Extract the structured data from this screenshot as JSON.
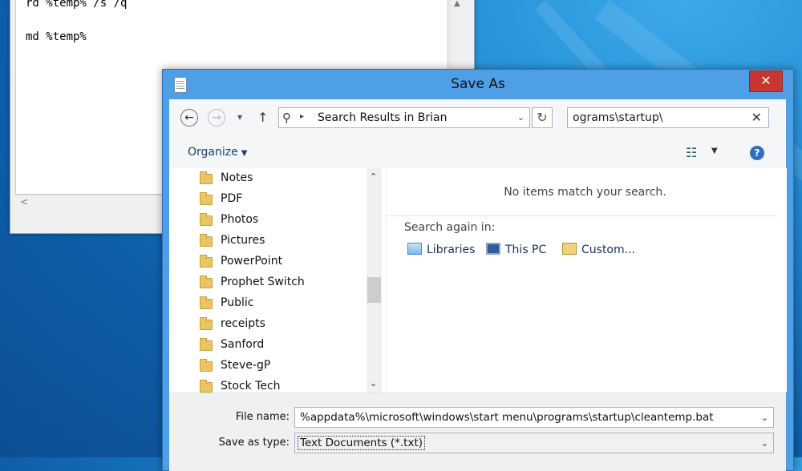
{
  "notepad": {
    "lines": [
      "rd %temp% /s /q",
      "",
      "md %temp%"
    ],
    "hscroll_left": "<"
  },
  "dialog": {
    "title": "Save As",
    "close_glyph": "✕",
    "nav": {
      "back_glyph": "←",
      "forward_glyph": "→",
      "recent_glyph": "▾",
      "up_glyph": "↑"
    },
    "address": {
      "search_icon": "⚲",
      "separator": "▸",
      "path": "Search Results in Brian",
      "dropdown": "⌄",
      "refresh_glyph": "↻"
    },
    "search": {
      "value": "ograms\\startup\\",
      "clear_glyph": "✕"
    },
    "toolbar": {
      "organize_label": "Organize",
      "organize_caret": "▼",
      "view_glyph": "☷",
      "view_caret": "▼",
      "help_glyph": "?"
    },
    "folders": [
      "Notes",
      "PDF",
      "Photos",
      "Pictures",
      "PowerPoint",
      "Prophet Switch",
      "Public",
      "receipts",
      "Sanford",
      "Steve-gP",
      "Stock Tech"
    ],
    "scroll": {
      "up": "⌃",
      "down": "⌄"
    },
    "results": {
      "empty_message": "No items match your search.",
      "search_again_label": "Search again in:",
      "locations": [
        "Libraries",
        "This PC",
        "Custom..."
      ]
    },
    "form": {
      "file_name_label": "File name:",
      "file_name_value": "%appdata%\\microsoft\\windows\\start menu\\programs\\startup\\cleantemp.bat",
      "save_type_label": "Save as type:",
      "save_type_value": "Text Documents (*.txt)",
      "dropdown_glyph": "⌄"
    }
  }
}
